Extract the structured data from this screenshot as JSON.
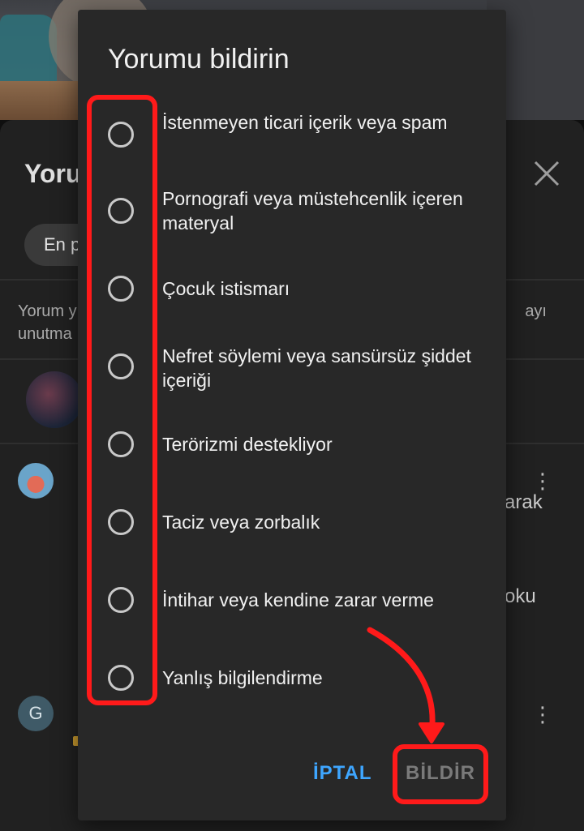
{
  "dialog": {
    "title": "Yorumu bildirin",
    "options": [
      {
        "label": "İstenmeyen ticari içerik veya spam"
      },
      {
        "label": "Pornografi veya müstehcenlik içeren materyal"
      },
      {
        "label": "Çocuk istismarı"
      },
      {
        "label": "Nefret söylemi veya sansürsüz şiddet içeriği"
      },
      {
        "label": "Terörizmi destekliyor"
      },
      {
        "label": "Taciz veya zorbalık"
      },
      {
        "label": "İntihar veya kendine zarar verme"
      },
      {
        "label": "Yanlış bilgilendirme"
      }
    ],
    "cancel_label": "İPTAL",
    "report_label": "BİLDİR"
  },
  "background": {
    "sheet_title": "Yoru",
    "sort_chip": "En p",
    "guidelines_line1": "Yorum y",
    "guidelines_line1_right": "ayı",
    "guidelines_line2": "unutma",
    "comment1_right_a": "arak",
    "comment1_right_b": "oku",
    "comment2_avatar_letter": "G",
    "kebab_glyph": "⋮"
  },
  "colors": {
    "accent_blue": "#3ea6ff",
    "annotation_red": "#ff1a1a",
    "dialog_bg": "#282828"
  }
}
